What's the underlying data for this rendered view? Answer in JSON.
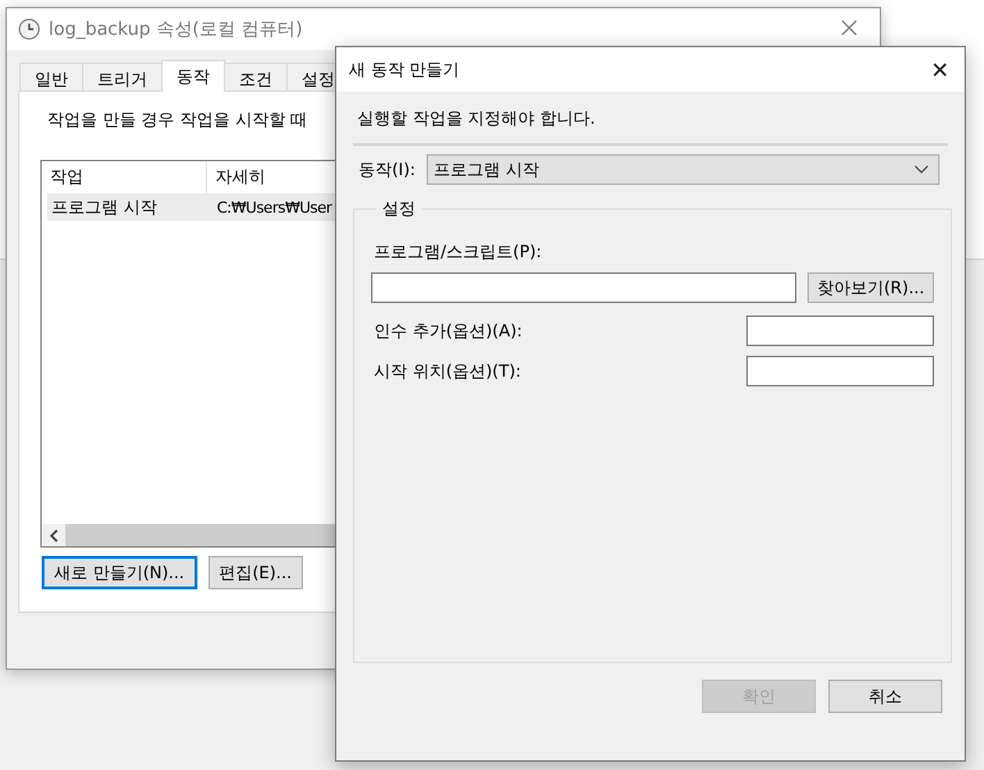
{
  "properties_window": {
    "title": "log_backup 속성(로컬 컴퓨터)",
    "tabs": [
      {
        "label": "일반",
        "selected": false
      },
      {
        "label": "트리거",
        "selected": false
      },
      {
        "label": "동작",
        "selected": true
      },
      {
        "label": "조건",
        "selected": false
      },
      {
        "label": "설정",
        "selected": false
      }
    ],
    "description": "작업을 만들 경우 작업을 시작할 때",
    "table": {
      "columns": [
        "작업",
        "자세히"
      ],
      "rows": [
        {
          "cells": [
            "프로그램 시작",
            "C:₩Users₩User"
          ],
          "selected": true
        }
      ]
    },
    "buttons": [
      {
        "label": "새로 만들기(N)...",
        "focused": true
      },
      {
        "label": "편집(E)...",
        "focused": false
      }
    ]
  },
  "dialog": {
    "title": "새 동작 만들기",
    "close": "✕",
    "instruction": "실행할 작업을 지정해야 합니다.",
    "action_label": "동작(I):",
    "action_value": "프로그램 시작",
    "group_title": "설정",
    "program_label": "프로그램/스크립트(P):",
    "browse_button": "찾아보기(R)...",
    "arguments_label": "인수 추가(옵션)(A):",
    "start_in_label": "시작 위치(옵션)(T):",
    "buttons": [
      {
        "label": "확인",
        "disabled": true
      },
      {
        "label": "취소",
        "disabled": false
      }
    ]
  }
}
